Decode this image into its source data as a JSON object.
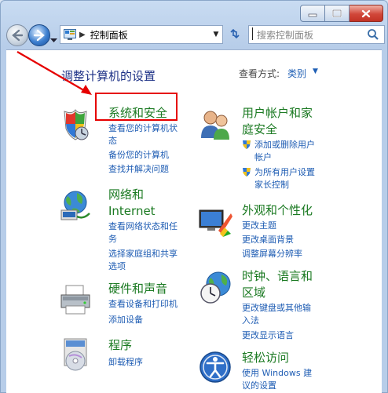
{
  "addressbar": {
    "path": "控制面板",
    "search_placeholder": "搜索控制面板"
  },
  "main": {
    "heading": "调整计算机的设置",
    "view_by_label": "查看方式:",
    "view_by_value": "类别"
  },
  "categories": {
    "system": {
      "title": "系统和安全",
      "links": [
        "查看您的计算机状",
        "态",
        "备份您的计算机",
        "查找并解决问题"
      ]
    },
    "network": {
      "title_1": "网络和",
      "title_2": "Internet",
      "links": [
        "查看网络状态和任",
        "务",
        "选择家庭组和共享",
        "选项"
      ]
    },
    "hardware": {
      "title": "硬件和声音",
      "links": [
        "查看设备和打印机",
        "添加设备"
      ]
    },
    "programs": {
      "title": "程序",
      "links": [
        "卸载程序"
      ]
    },
    "accounts": {
      "title_1": "用户帐户和家",
      "title_2": "庭安全",
      "links": [
        "添加或删除用户",
        "帐户",
        "为所有用户设置",
        "家长控制"
      ]
    },
    "appearance": {
      "title": "外观和个性化",
      "links": [
        "更改主题",
        "更改桌面背景",
        "调整屏幕分辨率"
      ]
    },
    "clock": {
      "title_1": "时钟、语言和",
      "title_2": "区域",
      "links": [
        "更改键盘或其他输",
        "入法",
        "更改显示语言"
      ]
    },
    "ease": {
      "title": "轻松访问",
      "links": [
        "使用 Windows 建",
        "议的设置"
      ]
    }
  },
  "colors": {
    "category_title": "#1b7a22",
    "link": "#1e5cb3",
    "heading": "#1e3287",
    "annotation": "#e60000"
  }
}
